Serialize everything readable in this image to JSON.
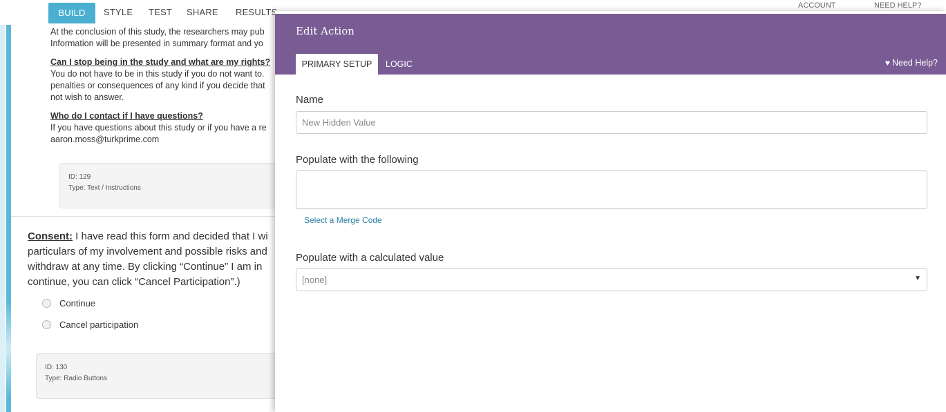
{
  "topnav": {
    "tabs": [
      "BUILD",
      "STYLE",
      "TEST",
      "SHARE",
      "RESULTS"
    ],
    "active": "BUILD",
    "account": "ACCOUNT",
    "need_help": "NEED HELP?"
  },
  "survey": {
    "conclusion": [
      "At the conclusion of this study, the researchers may pub",
      "Information will be presented in summary format and yo"
    ],
    "rights_heading": "Can I stop being in the study and what are my rights?",
    "rights_text": [
      "You do not have to be in this study if you do not want to.",
      "penalties or consequences of any kind if you decide that",
      "not wish to answer."
    ],
    "contact_heading": "Who do I contact if I have questions?",
    "contact_text": [
      "If you have  questions about this study or if you have a re",
      "aaron.moss@turkprime.com"
    ],
    "block1": {
      "id": "ID: 129",
      "type": "Type: Text / Instructions"
    },
    "consent_label": "Consent:",
    "consent_lines": [
      " I have read this form and decided that I wi",
      "particulars of my involvement and possible risks and",
      "withdraw at any time. By clicking “Continue” I am in",
      "continue, you can click “Cancel Participation”.)"
    ],
    "options": [
      "Continue",
      "Cancel participation"
    ],
    "block2": {
      "id": "ID: 130",
      "type": "Type: Radio Buttons"
    }
  },
  "modal": {
    "title": "Edit Action",
    "tabs": [
      "PRIMARY SETUP",
      "LOGIC"
    ],
    "need_help": "Need Help?",
    "name_label": "Name",
    "name_value": "New Hidden Value",
    "populate_label": "Populate with the following",
    "merge_link": "Select a Merge Code",
    "calc_label": "Populate with a calculated value",
    "calc_value": "[none]"
  },
  "colors": {
    "header_purple": "#7a5c94",
    "build_tab_blue": "#4aafd1",
    "link_blue": "#2a7fa0"
  }
}
